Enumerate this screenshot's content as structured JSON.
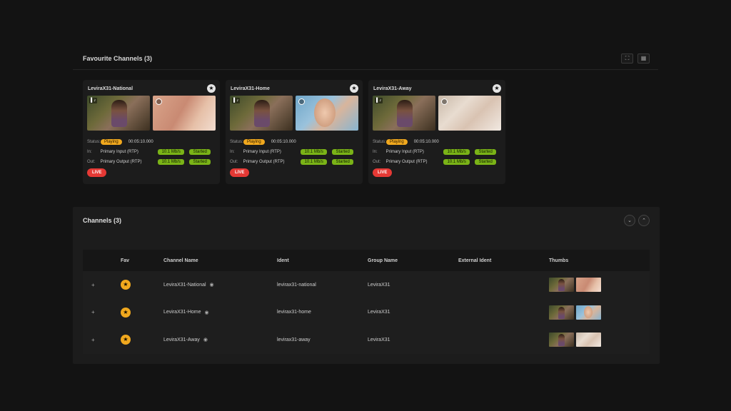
{
  "favourites": {
    "title": "Favourite Channels (3)",
    "header_icons": [
      "fullscreen-icon",
      "grid-icon"
    ],
    "cards": [
      {
        "name": "LeviraX31-National",
        "thumb2_style": "skin",
        "status_label": "Status:",
        "status": "Playing",
        "time": "00:05:10.000",
        "in_label": "In:",
        "in_name": "Primary Input (RTP)",
        "in_rate": "10.1 Mb/s",
        "in_state": "Started",
        "out_label": "Out:",
        "out_name": "Primary Output (RTP)",
        "out_rate": "10.1 Mb/s",
        "out_state": "Started",
        "live": "LIVE"
      },
      {
        "name": "LeviraX31-Home",
        "thumb2_style": "face",
        "status_label": "Status:",
        "status": "Playing",
        "time": "00:05:10.000",
        "in_label": "In:",
        "in_name": "Primary Input (RTP)",
        "in_rate": "10.1 Mb/s",
        "in_state": "Started",
        "out_label": "Out:",
        "out_name": "Primary Output (RTP)",
        "out_rate": "10.1 Mb/s",
        "out_state": "Started",
        "live": "LIVE"
      },
      {
        "name": "LeviraX31-Away",
        "thumb2_style": "baby",
        "status_label": "Status:",
        "status": "Playing",
        "time": "00:05:10.000",
        "in_label": "In:",
        "in_name": "Primary Input (RTP)",
        "in_rate": "10.1 Mb/s",
        "in_state": "Started",
        "out_label": "Out:",
        "out_name": "Primary Output (RTP)",
        "out_rate": "10.1 Mb/s",
        "out_state": "Started",
        "live": "LIVE"
      }
    ]
  },
  "channels": {
    "title": "Channels (3)",
    "columns": {
      "fav": "Fav",
      "name": "Channel Name",
      "ident": "Ident",
      "group": "Group Name",
      "external": "External Ident",
      "thumbs": "Thumbs"
    },
    "rows": [
      {
        "expand": "+",
        "name": "LeviraX31-National",
        "ident": "levirax31-national",
        "group": "LeviraX31",
        "external": "",
        "thumb2_style": "skin"
      },
      {
        "expand": "+",
        "name": "LeviraX31-Home",
        "ident": "levirax31-home",
        "group": "LeviraX31",
        "external": "",
        "thumb2_style": "face"
      },
      {
        "expand": "+",
        "name": "LeviraX31-Away",
        "ident": "levirax31-away",
        "group": "LeviraX31",
        "external": "",
        "thumb2_style": "baby"
      }
    ]
  },
  "colors": {
    "background": "#131313",
    "panel": "#1c1c1c",
    "playing": "#f0a81e",
    "started": "#7ab317",
    "live": "#e53935",
    "fav": "#f0a81e"
  }
}
